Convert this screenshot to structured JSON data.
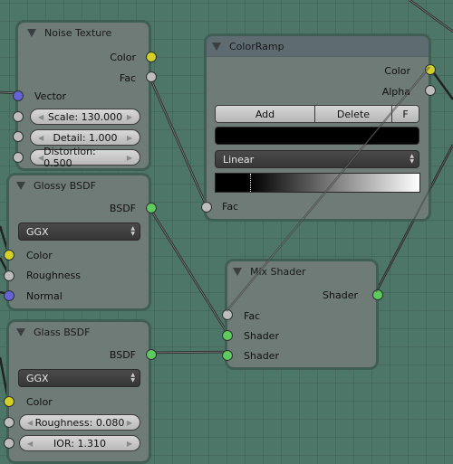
{
  "editor": "Node Editor",
  "nodes": {
    "noise_texture": {
      "title": "Noise Texture",
      "outputs": [
        {
          "label": "Color",
          "socket": "yellow"
        },
        {
          "label": "Fac",
          "socket": "gray"
        }
      ],
      "inputs": [
        {
          "label": "Vector",
          "socket": "blue"
        }
      ],
      "fields": [
        {
          "label": "Scale: 130.000",
          "name": "Scale",
          "value": 130.0
        },
        {
          "label": "Detail: 1.000",
          "name": "Detail",
          "value": 1.0
        },
        {
          "label": "Distortion: 0.500",
          "name": "Distortion",
          "value": 0.5
        }
      ]
    },
    "glossy_bsdf": {
      "title": "Glossy BSDF",
      "outputs": [
        {
          "label": "BSDF",
          "socket": "green"
        }
      ],
      "distribution": "GGX",
      "inputs": [
        {
          "label": "Color",
          "socket": "yellow"
        },
        {
          "label": "Roughness",
          "socket": "gray"
        },
        {
          "label": "Normal",
          "socket": "blue"
        }
      ]
    },
    "glass_bsdf": {
      "title": "Glass BSDF",
      "outputs": [
        {
          "label": "BSDF",
          "socket": "green"
        }
      ],
      "distribution": "GGX",
      "inputs": [
        {
          "label": "Color",
          "socket": "yellow"
        }
      ],
      "fields": [
        {
          "label": "Roughness: 0.080",
          "name": "Roughness",
          "value": 0.08
        },
        {
          "label": "IOR: 1.310",
          "name": "IOR",
          "value": 1.31
        }
      ]
    },
    "color_ramp": {
      "title": "ColorRamp",
      "outputs": [
        {
          "label": "Color",
          "socket": "yellow"
        },
        {
          "label": "Alpha",
          "socket": "gray"
        }
      ],
      "buttons": {
        "add": "Add",
        "delete": "Delete",
        "flip": "F"
      },
      "active_color": "#000000",
      "interpolation": "Linear",
      "stops": [
        {
          "position": 0.17,
          "color": "#000000"
        },
        {
          "position": 1.0,
          "color": "#ffffff"
        }
      ],
      "inputs": [
        {
          "label": "Fac",
          "socket": "gray"
        }
      ]
    },
    "mix_shader": {
      "title": "Mix Shader",
      "outputs": [
        {
          "label": "Shader",
          "socket": "green"
        }
      ],
      "inputs": [
        {
          "label": "Fac",
          "socket": "gray"
        },
        {
          "label": "Shader",
          "socket": "green"
        },
        {
          "label": "Shader",
          "socket": "green"
        }
      ]
    }
  },
  "colors": {
    "background": "#4d7568",
    "node_body": "#6e7b76",
    "socket_color": "#d4d02a",
    "socket_float": "#bdbdbd",
    "socket_vector": "#6464d6",
    "socket_shader": "#5ecb5e"
  }
}
